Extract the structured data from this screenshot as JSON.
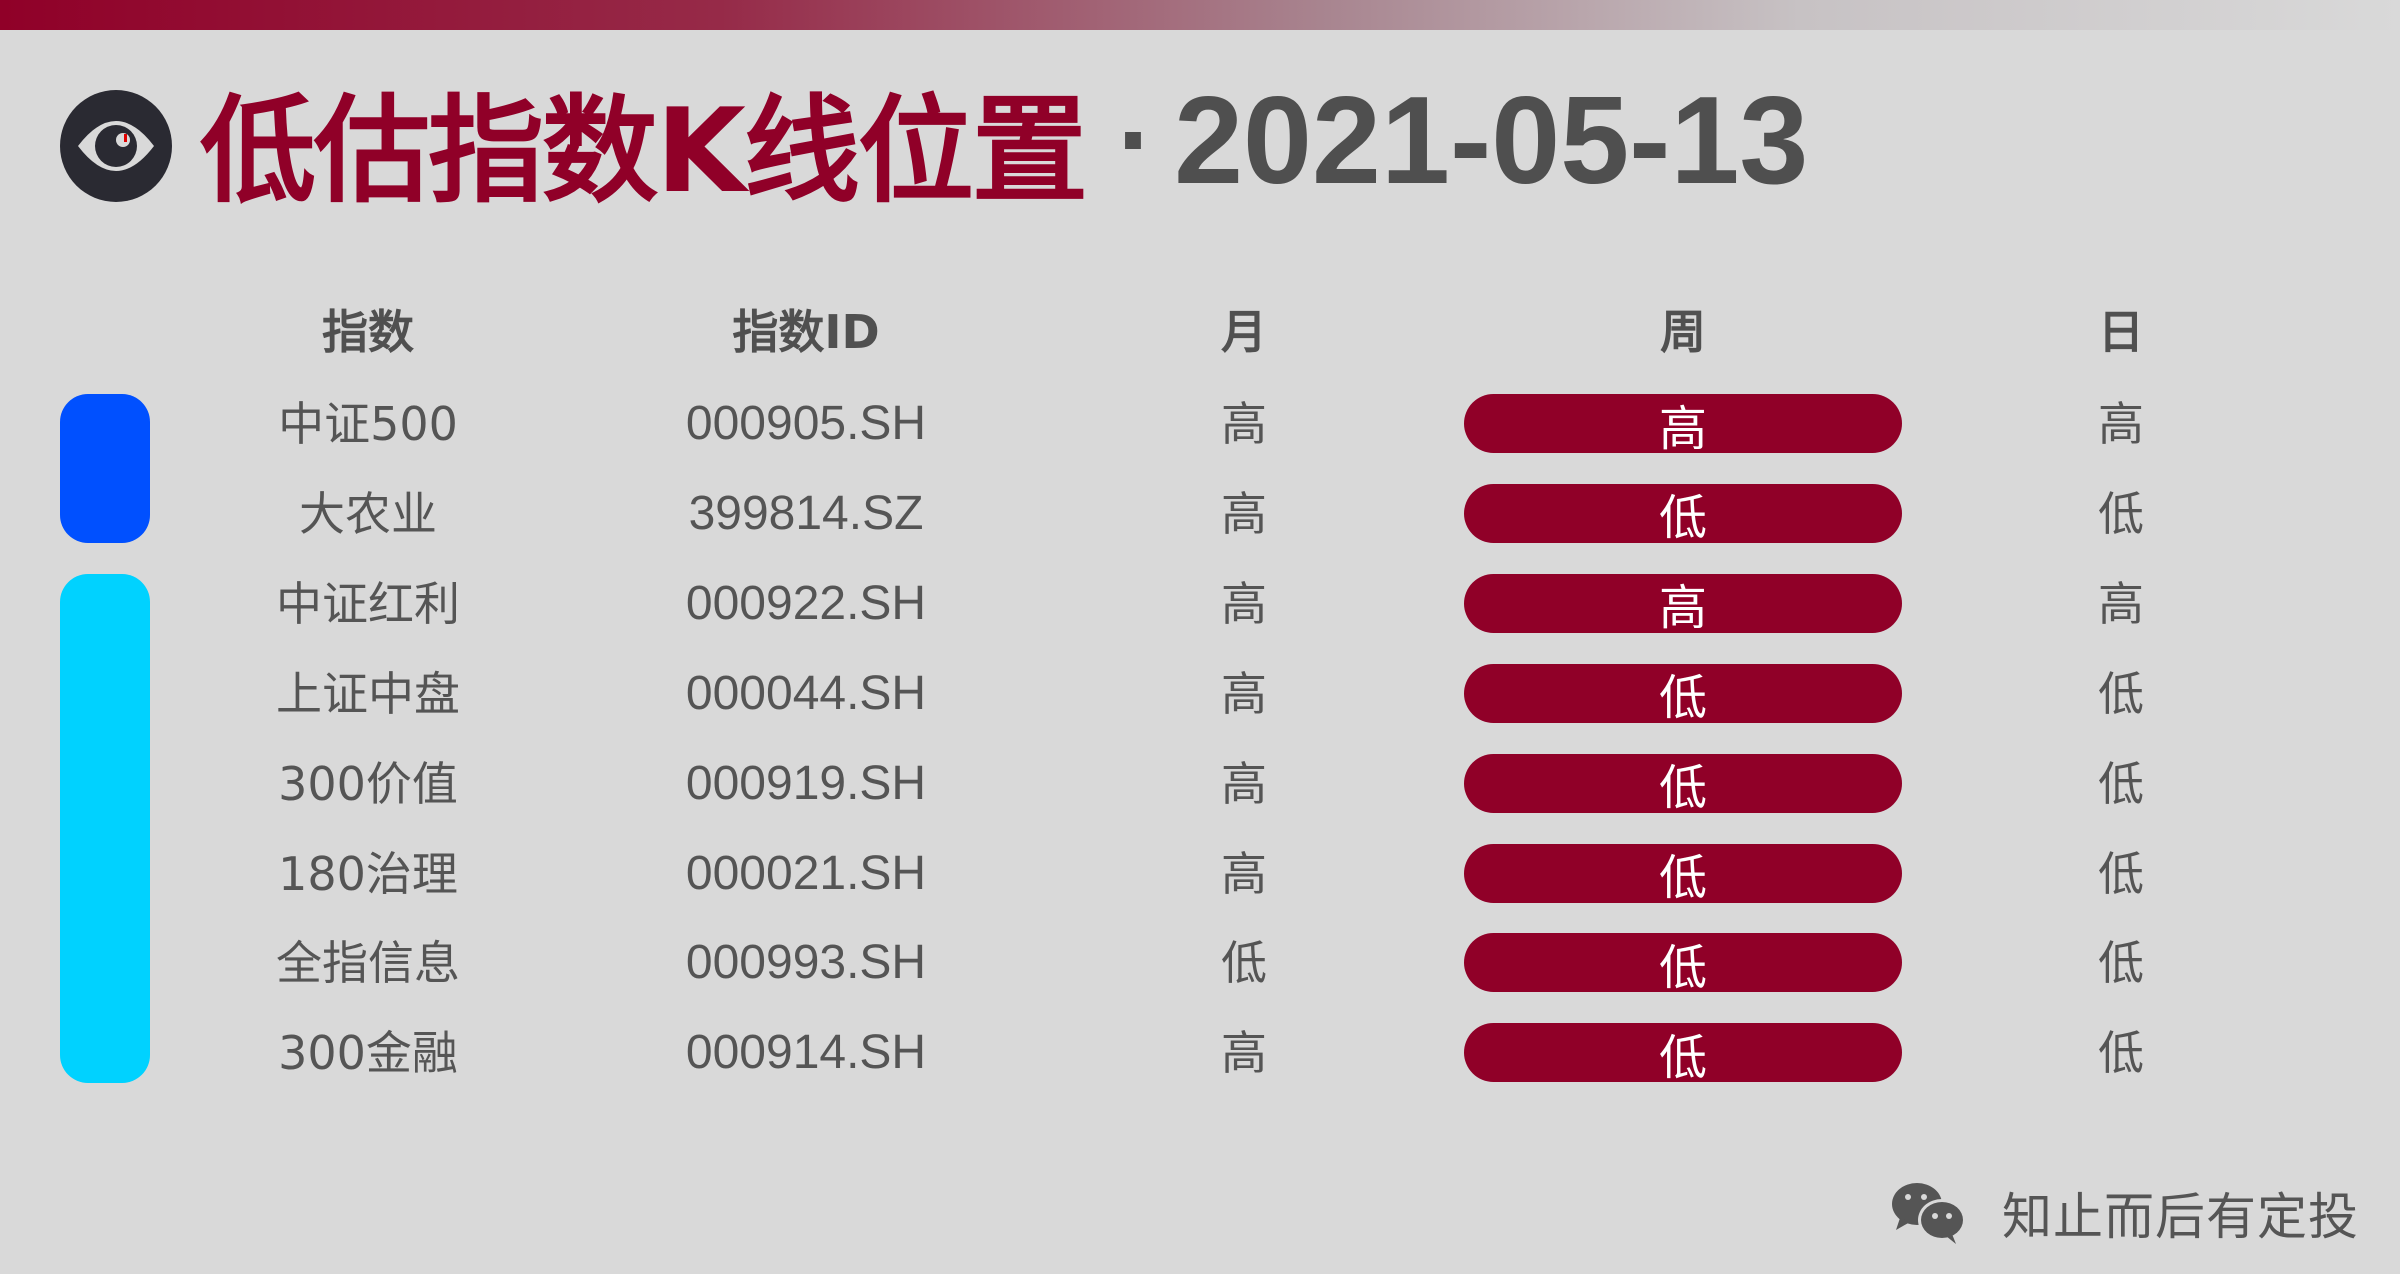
{
  "header": {
    "title": "低估指数K线位置",
    "separator": "·",
    "date": "2021-05-13",
    "icon": "eye-icon"
  },
  "colors": {
    "accent": "#900028",
    "text": "#555555",
    "date_text": "#4f4f4f",
    "background": "#d9d9d9",
    "group_blue": "#0050ff",
    "group_cyan": "#00d2ff",
    "pill_text": "#ffffff"
  },
  "table": {
    "columns": [
      "指数",
      "指数ID",
      "月",
      "周",
      "日"
    ],
    "rows": [
      {
        "name": "中证500",
        "id": "000905.SH",
        "month": "高",
        "week": "高",
        "day": "高",
        "group": "blue"
      },
      {
        "name": "大农业",
        "id": "399814.SZ",
        "month": "高",
        "week": "低",
        "day": "低",
        "group": "blue"
      },
      {
        "name": "中证红利",
        "id": "000922.SH",
        "month": "高",
        "week": "高",
        "day": "高",
        "group": "cyan"
      },
      {
        "name": "上证中盘",
        "id": "000044.SH",
        "month": "高",
        "week": "低",
        "day": "低",
        "group": "cyan"
      },
      {
        "name": "300价值",
        "id": "000919.SH",
        "month": "高",
        "week": "低",
        "day": "低",
        "group": "cyan"
      },
      {
        "name": "180治理",
        "id": "000021.SH",
        "month": "高",
        "week": "低",
        "day": "低",
        "group": "cyan"
      },
      {
        "name": "全指信息",
        "id": "000993.SH",
        "month": "低",
        "week": "低",
        "day": "低",
        "group": "cyan"
      },
      {
        "name": "300金融",
        "id": "000914.SH",
        "month": "高",
        "week": "低",
        "day": "低",
        "group": "cyan"
      }
    ]
  },
  "footer": {
    "icon": "wechat-icon",
    "label": "知止而后有定投"
  }
}
